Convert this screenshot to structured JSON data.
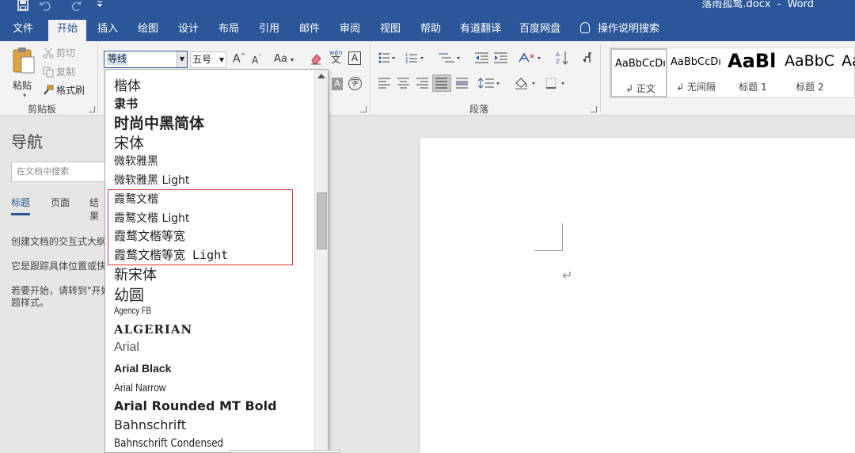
{
  "titlebar": {
    "doc_name": "落雨孤鹜.docx",
    "sep": "-",
    "app": "Word",
    "save_icon": "save-icon",
    "undo_icon": "undo-icon",
    "redo_icon": "redo-icon",
    "customize_icon": "customize-qat-icon"
  },
  "tabs": [
    "文件",
    "开始",
    "插入",
    "绘图",
    "设计",
    "布局",
    "引用",
    "邮件",
    "审阅",
    "视图",
    "帮助",
    "有道翻译",
    "百度网盘"
  ],
  "active_tab": "开始",
  "tell_me": "操作说明搜索",
  "clipboard": {
    "paste": "粘贴",
    "cut": "剪切",
    "copy": "复制",
    "format_painter": "格式刷",
    "group_label": "剪贴板"
  },
  "font": {
    "current_font": "等线",
    "current_size": "五号",
    "grow": "A",
    "shrink": "A",
    "case": "Aa",
    "wen": "wén",
    "wen_char": "文",
    "border_char": "A",
    "enclose_char": "字"
  },
  "paragraph": {
    "group_label": "段落"
  },
  "styles": [
    {
      "preview": "AaBbCcDı",
      "name": "↲ 正文"
    },
    {
      "preview": "AaBbCcDı",
      "name": "↲ 无间隔"
    },
    {
      "preview": "AaBl",
      "name": "标题 1"
    },
    {
      "preview": "AaBbC",
      "name": "标题 2"
    },
    {
      "preview": "Aa",
      "name": ""
    }
  ],
  "nav": {
    "title": "导航",
    "search_placeholder": "在文档中搜索",
    "tabs": [
      "标题",
      "页面",
      "结果"
    ],
    "line1": "创建文档的交互式大纲",
    "line2": "它是跟踪具体位置或快",
    "line3": "若要开始，请转到\"开始",
    "line4": "题样式。"
  },
  "document": {
    "para_mark": "↵"
  },
  "font_list": [
    "楷体",
    "隶书",
    "时尚中黑简体",
    "宋体",
    "微软雅黑",
    "微软雅黑 Light",
    "霞鹜文楷",
    "霞鹜文楷 Light",
    "霞鹜文楷等宽",
    "霞鹜文楷等宽 Light",
    "新宋体",
    "幼圆",
    "Agency FB",
    "ALGERIAN",
    "Arial",
    "Arial Black",
    "Arial Narrow",
    "Arial Rounded MT Bold",
    "Bahnschrift",
    "Bahnschrift Condensed"
  ]
}
